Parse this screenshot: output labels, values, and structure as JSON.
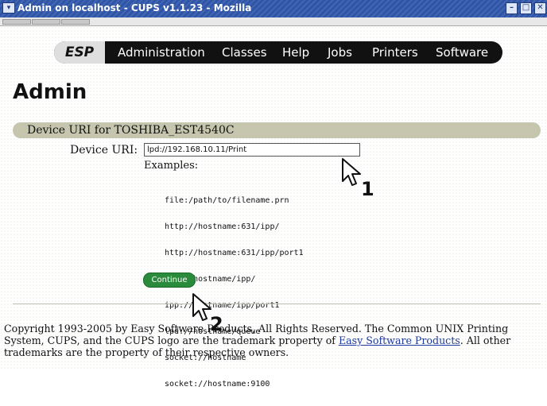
{
  "window": {
    "title": "Admin on localhost - CUPS v1.1.23 - Mozilla",
    "menu_glyph": "▾",
    "minimize_glyph": "–",
    "maximize_glyph": "□",
    "close_glyph": "✕"
  },
  "nav": {
    "logo": "ESP",
    "items": [
      "Administration",
      "Classes",
      "Help",
      "Jobs",
      "Printers",
      "Software"
    ]
  },
  "page": {
    "heading": "Admin",
    "section_title": "Device URI for TOSHIBA_EST4540C",
    "uri_label": "Device URI:",
    "uri_value": "lpd://192.168.10.11/Print",
    "examples_label": "Examples:",
    "examples": [
      "file:/path/to/filename.prn",
      "http://hostname:631/ipp/",
      "http://hostname:631/ipp/port1",
      "ipp://hostname/ipp/",
      "ipp://hostname/ipp/port1",
      "lpd://hostname/queue",
      "socket://hostname",
      "socket://hostname:9100"
    ],
    "continue_label": "Continue"
  },
  "footer": {
    "text_1": "Copyright 1993-2005 by Easy Software Products, All Rights Reserved. The Common UNIX Printing System, CUPS, and the CUPS logo are the trademark property of ",
    "link": "Easy Software Products",
    "text_2": ". All other trademarks are the property of their respective owners."
  },
  "callouts": {
    "one": "1",
    "two": "2"
  }
}
